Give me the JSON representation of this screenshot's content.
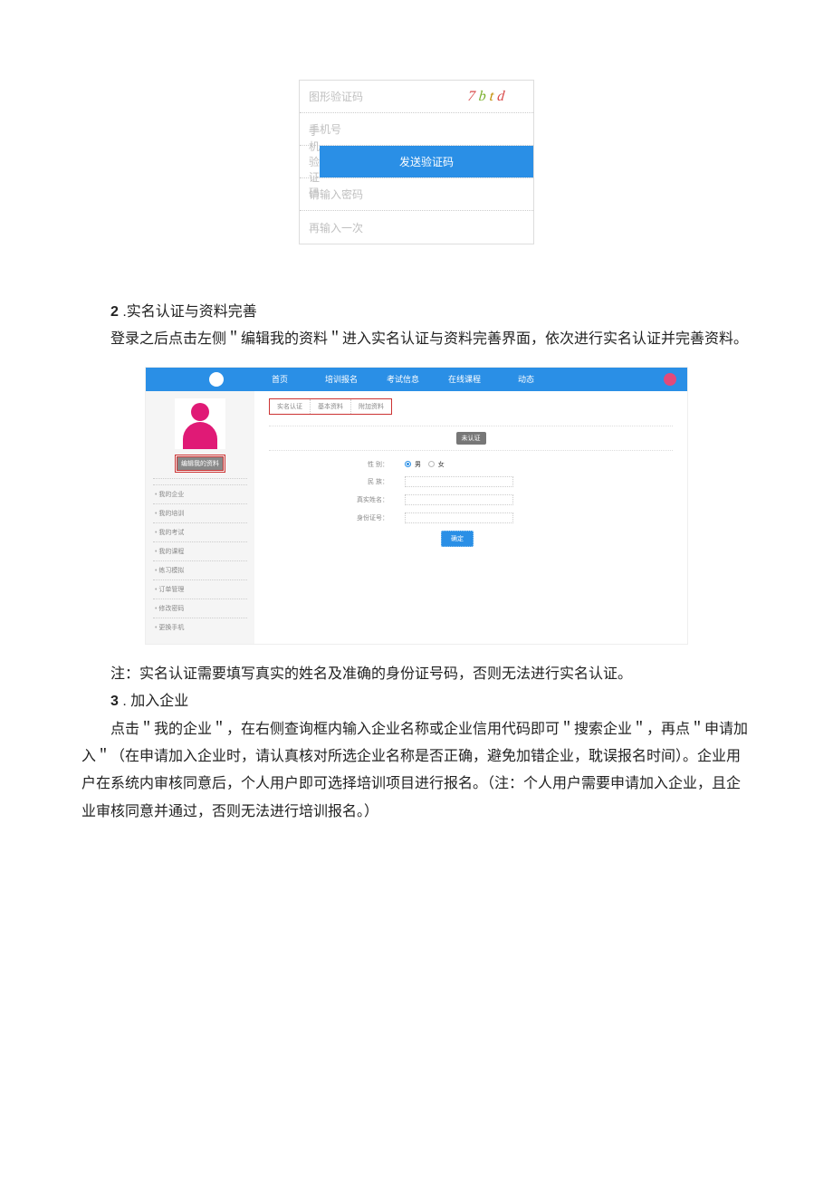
{
  "reg_form": {
    "captcha_label": "图形验证码",
    "captcha_value": "7btd",
    "phone_label": "手机号",
    "sms_label": "手机验证码",
    "send_btn": "发送验证码",
    "pwd_label": "请输入密码",
    "pwd2_label": "再输入一次"
  },
  "section2": {
    "num": "2",
    "title": ".实名认证与资料完善",
    "para": "登录之后点击左侧＂编辑我的资料＂进入实名认证与资料完善界面，依次进行实名认证并完善资料。",
    "note": "注：实名认证需要填写真实的姓名及准确的身份证号码，否则无法进行实名认证。"
  },
  "app": {
    "nav": [
      "首页",
      "培训报名",
      "考试信息",
      "在线课程",
      "动态"
    ],
    "sidebar": {
      "edit_label": "编辑我的资料",
      "items": [
        "我的企业",
        "我的培训",
        "我的考试",
        "我的课程",
        "练习模拟",
        "订单管理",
        "修改密码",
        "更换手机"
      ]
    },
    "tabs": [
      "实名认证",
      "基本资料",
      "附加资料"
    ],
    "status_badge": "未认证",
    "form": {
      "gender_label": "性 别：",
      "gender_male": "男",
      "gender_female": "女",
      "ethnic_label": "民 族：",
      "name_label": "真实姓名：",
      "id_label": "身份证号：",
      "submit": "确定"
    }
  },
  "section3": {
    "num": "3",
    "title": ". 加入企业",
    "para": "点击＂我的企业＂，在右侧查询框内输入企业名称或企业信用代码即可＂搜索企业＂，再点＂申请加入＂（在申请加入企业时，请认真核对所选企业名称是否正确，避免加错企业，耽误报名时间）。企业用户在系统内审核同意后，个人用户即可选择培训项目进行报名。（注：个人用户需要申请加入企业，且企业审核同意并通过，否则无法进行培训报名。）"
  }
}
